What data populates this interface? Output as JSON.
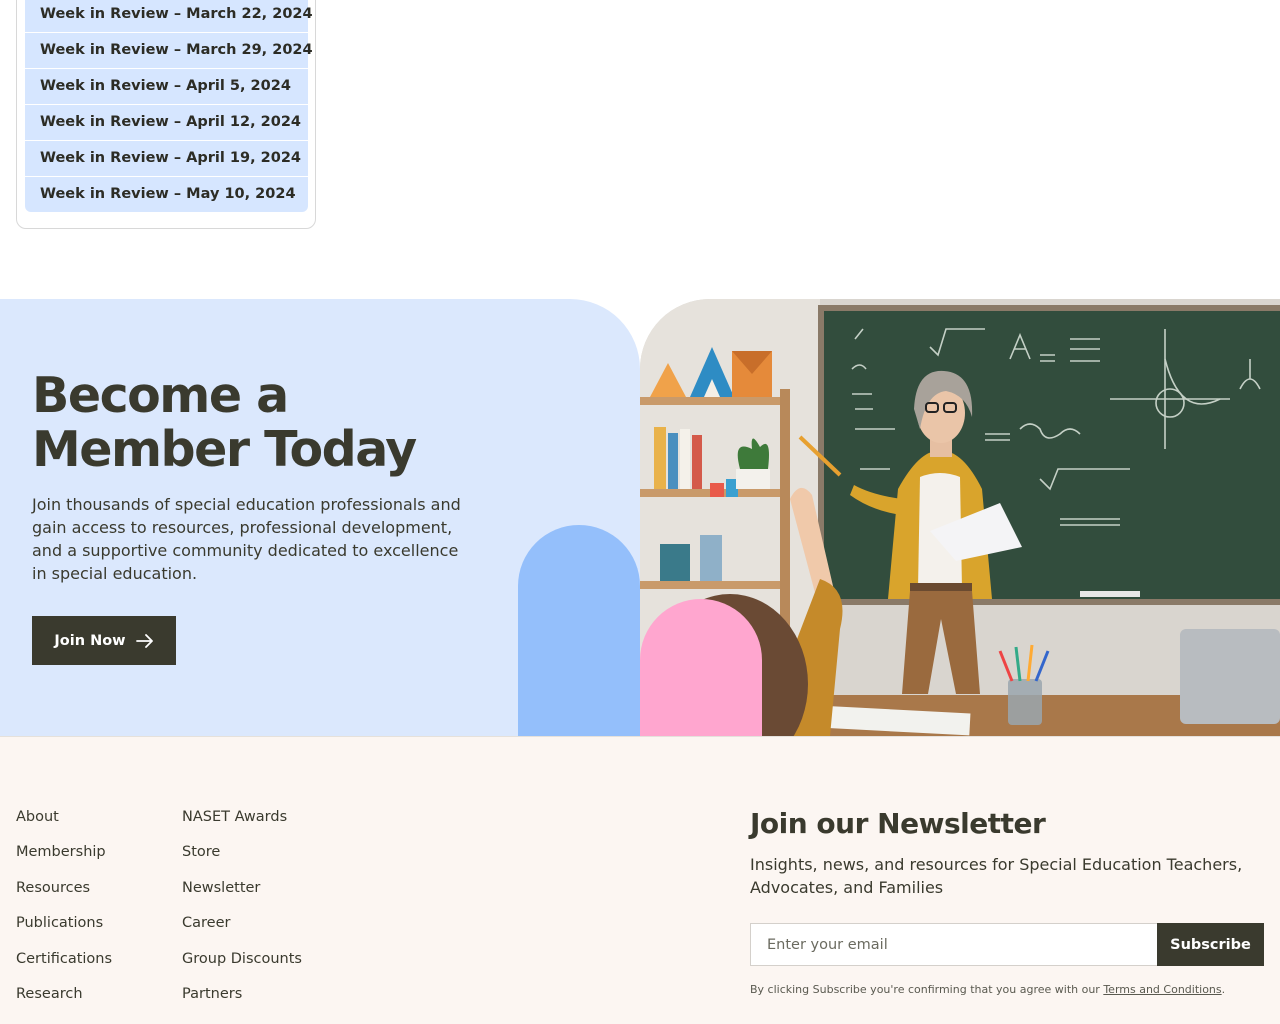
{
  "review_list": {
    "items": [
      "Week in Review – March 22, 2024",
      "Week in Review – March 29, 2024",
      "Week in Review – April 5, 2024",
      "Week in Review – April 12, 2024",
      "Week in Review – April 19, 2024",
      "Week in Review – May 10, 2024"
    ]
  },
  "member": {
    "title": "Become a Member Today",
    "text": "Join thousands of special education professionals and gain access to resources, professional development, and a supportive community dedicated to excellence in special education.",
    "button_label": "Join Now",
    "colors": {
      "panel": "#dbe8fd",
      "arch_blue": "#94bffb",
      "arch_pink": "#ffa6cf",
      "button": "#3a3a2e"
    }
  },
  "footer": {
    "links_col1": [
      "About",
      "Membership",
      "Resources",
      "Publications",
      "Certifications",
      "Research"
    ],
    "links_col2": [
      "NASET Awards",
      "Store",
      "Newsletter",
      "Career",
      "Group Discounts",
      "Partners"
    ],
    "newsletter": {
      "title": "Join our Newsletter",
      "subtitle": "Insights, news, and resources for Special Education Teachers, Advocates, and Families",
      "email_placeholder": "Enter your email",
      "subscribe_label": "Subscribe",
      "legal_prefix": "By clicking Subscribe you're confirming that you agree with our ",
      "legal_link": "Terms and Conditions",
      "legal_suffix": "."
    },
    "background": "#fcf6f2"
  }
}
